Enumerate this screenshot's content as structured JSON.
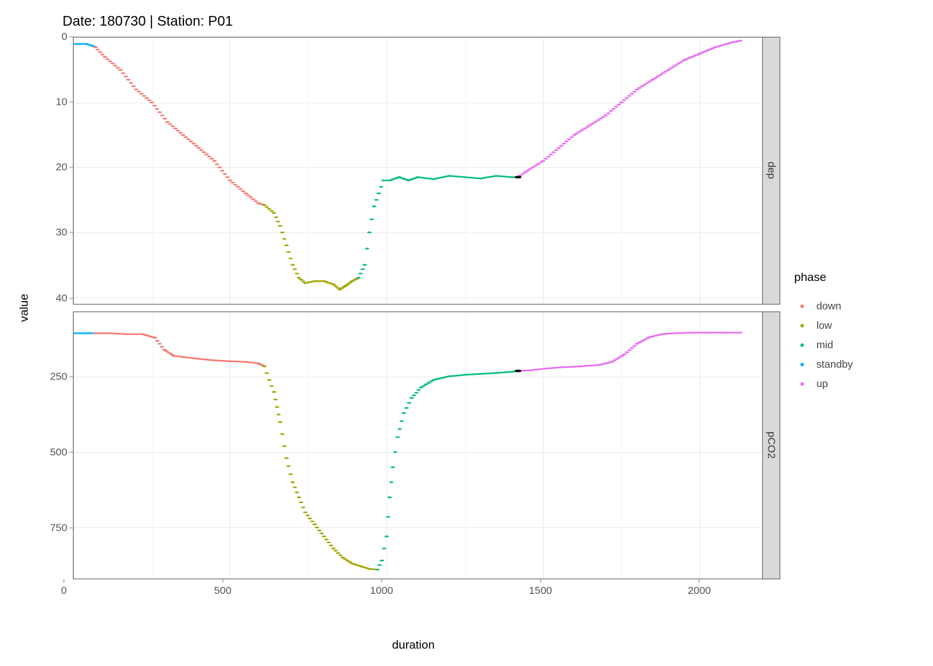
{
  "chart_data": {
    "type": "scatter",
    "title": "Date: 180730 | Station: P01",
    "xlabel": "duration",
    "ylabel": "value",
    "xlim": [
      0,
      2200
    ],
    "xticks": [
      0,
      500,
      1000,
      1500,
      2000
    ],
    "legend_title": "phase",
    "colors": {
      "down": "#F8766D",
      "low": "#A3A500",
      "mid": "#00BF7D",
      "standby": "#00B0F6",
      "up": "#E76BF3"
    },
    "legend_order": [
      "down",
      "low",
      "mid",
      "standby",
      "up"
    ],
    "facets": [
      {
        "name": "dep",
        "ylim": [
          41,
          0
        ],
        "yticks": [
          0,
          10,
          20,
          30,
          40
        ],
        "reversed": true,
        "black_point": {
          "x": 1420,
          "y": 21.5
        },
        "segments": [
          {
            "phase": "standby",
            "points": [
              [
                5,
                1
              ],
              [
                20,
                1
              ],
              [
                40,
                1
              ],
              [
                55,
                1.2
              ],
              [
                70,
                1.5
              ]
            ]
          },
          {
            "phase": "down",
            "points": [
              [
                70,
                1.5
              ],
              [
                100,
                3
              ],
              [
                150,
                5
              ],
              [
                200,
                8
              ],
              [
                250,
                10
              ],
              [
                300,
                13
              ],
              [
                350,
                15
              ],
              [
                400,
                17
              ],
              [
                450,
                19
              ],
              [
                500,
                22
              ],
              [
                550,
                24
              ],
              [
                590,
                25.5
              ],
              [
                610,
                25.8
              ]
            ]
          },
          {
            "phase": "low",
            "points": [
              [
                610,
                25.8
              ],
              [
                640,
                27
              ],
              [
                660,
                29
              ],
              [
                680,
                32
              ],
              [
                700,
                35
              ],
              [
                720,
                37
              ],
              [
                740,
                37.8
              ],
              [
                770,
                37.5
              ],
              [
                800,
                37.5
              ],
              [
                830,
                38
              ],
              [
                850,
                38.8
              ],
              [
                870,
                38.2
              ],
              [
                890,
                37.5
              ],
              [
                910,
                37
              ]
            ]
          },
          {
            "phase": "mid",
            "points": [
              [
                910,
                37
              ],
              [
                930,
                35
              ],
              [
                945,
                30
              ],
              [
                960,
                26
              ],
              [
                975,
                24
              ],
              [
                990,
                22
              ],
              [
                1010,
                22
              ],
              [
                1040,
                21.5
              ],
              [
                1070,
                22
              ],
              [
                1100,
                21.5
              ],
              [
                1150,
                21.8
              ],
              [
                1200,
                21.3
              ],
              [
                1250,
                21.5
              ],
              [
                1300,
                21.7
              ],
              [
                1350,
                21.3
              ],
              [
                1400,
                21.5
              ],
              [
                1420,
                21.5
              ]
            ]
          },
          {
            "phase": "up",
            "points": [
              [
                1420,
                21.5
              ],
              [
                1450,
                20.5
              ],
              [
                1500,
                19
              ],
              [
                1550,
                17
              ],
              [
                1600,
                15
              ],
              [
                1650,
                13.5
              ],
              [
                1700,
                12
              ],
              [
                1750,
                10
              ],
              [
                1800,
                8
              ],
              [
                1850,
                6.5
              ],
              [
                1900,
                5
              ],
              [
                1950,
                3.5
              ],
              [
                2000,
                2.5
              ],
              [
                2050,
                1.5
              ],
              [
                2100,
                0.8
              ],
              [
                2130,
                0.5
              ]
            ]
          }
        ]
      },
      {
        "name": "pCO2",
        "ylim": [
          35,
          920
        ],
        "yticks": [
          250,
          500,
          750
        ],
        "reversed": false,
        "black_point": {
          "x": 1420,
          "y": 230
        },
        "segments": [
          {
            "phase": "standby",
            "points": [
              [
                5,
                105
              ],
              [
                30,
                105
              ],
              [
                50,
                105
              ],
              [
                70,
                105
              ]
            ]
          },
          {
            "phase": "down",
            "points": [
              [
                70,
                105
              ],
              [
                120,
                105
              ],
              [
                170,
                108
              ],
              [
                220,
                108
              ],
              [
                260,
                120
              ],
              [
                290,
                160
              ],
              [
                320,
                180
              ],
              [
                360,
                185
              ],
              [
                400,
                190
              ],
              [
                450,
                195
              ],
              [
                500,
                198
              ],
              [
                550,
                200
              ],
              [
                590,
                205
              ],
              [
                610,
                215
              ]
            ]
          },
          {
            "phase": "low",
            "points": [
              [
                610,
                215
              ],
              [
                625,
                260
              ],
              [
                640,
                300
              ],
              [
                650,
                350
              ],
              [
                660,
                400
              ],
              [
                680,
                520
              ],
              [
                700,
                600
              ],
              [
                720,
                650
              ],
              [
                740,
                700
              ],
              [
                770,
                740
              ],
              [
                800,
                780
              ],
              [
                830,
                820
              ],
              [
                860,
                850
              ],
              [
                890,
                870
              ],
              [
                920,
                880
              ],
              [
                945,
                888
              ],
              [
                970,
                890
              ]
            ]
          },
          {
            "phase": "mid",
            "points": [
              [
                970,
                890
              ],
              [
                985,
                860
              ],
              [
                1000,
                780
              ],
              [
                1010,
                650
              ],
              [
                1020,
                550
              ],
              [
                1035,
                450
              ],
              [
                1055,
                370
              ],
              [
                1080,
                320
              ],
              [
                1110,
                285
              ],
              [
                1150,
                260
              ],
              [
                1200,
                248
              ],
              [
                1250,
                243
              ],
              [
                1300,
                240
              ],
              [
                1350,
                237
              ],
              [
                1400,
                233
              ],
              [
                1420,
                230
              ]
            ]
          },
          {
            "phase": "up",
            "points": [
              [
                1420,
                230
              ],
              [
                1460,
                228
              ],
              [
                1510,
                222
              ],
              [
                1560,
                218
              ],
              [
                1620,
                215
              ],
              [
                1680,
                210
              ],
              [
                1720,
                200
              ],
              [
                1760,
                175
              ],
              [
                1800,
                140
              ],
              [
                1840,
                118
              ],
              [
                1880,
                108
              ],
              [
                1920,
                105
              ],
              [
                1970,
                103
              ],
              [
                2020,
                103
              ],
              [
                2080,
                103
              ],
              [
                2130,
                103
              ]
            ]
          }
        ]
      }
    ]
  }
}
